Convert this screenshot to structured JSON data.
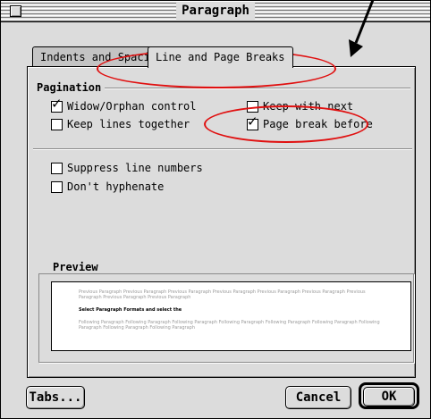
{
  "window": {
    "title": "Paragraph"
  },
  "tabs": [
    {
      "label": "Indents and Spacing",
      "selected": false
    },
    {
      "label": "Line and Page Breaks",
      "selected": true
    }
  ],
  "pagination": {
    "heading": "Pagination",
    "options": [
      {
        "label": "Widow/Orphan control",
        "checked": true
      },
      {
        "label": "Keep lines together",
        "checked": false
      },
      {
        "label": "Keep with next",
        "checked": false
      },
      {
        "label": "Page break before",
        "checked": true
      }
    ]
  },
  "other_options": [
    {
      "label": "Suppress line numbers",
      "checked": false
    },
    {
      "label": "Don't hyphenate",
      "checked": false
    }
  ],
  "preview": {
    "heading": "Preview",
    "previous_text": "Previous Paragraph Previous Paragraph Previous Paragraph Previous Paragraph Previous Paragraph Previous Paragraph Previous Paragraph Previous Paragraph Previous Paragraph",
    "current_text": "Select Paragraph Formats and select the",
    "following_text": "Following Paragraph Following Paragraph Following Paragraph Following Paragraph Following Paragraph Following Paragraph Following Paragraph Following Paragraph Following Paragraph"
  },
  "buttons": {
    "tabs": "Tabs...",
    "cancel": "Cancel",
    "ok": "OK"
  },
  "annotation_color": "#e01010"
}
